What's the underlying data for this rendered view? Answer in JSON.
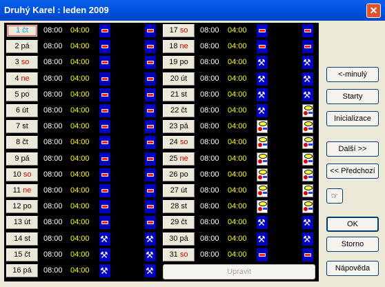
{
  "window": {
    "title": "Druhý Karel : leden 2009",
    "close_label": "✕"
  },
  "left_days": [
    {
      "num": "1",
      "wd": "čt",
      "t1": "08:00",
      "t2": "04:00",
      "i1": "bar",
      "i2": "bar",
      "selected": true
    },
    {
      "num": "2",
      "wd": "pá",
      "t1": "08:00",
      "t2": "04:00",
      "i1": "bar",
      "i2": "bar"
    },
    {
      "num": "3",
      "wd": "so",
      "t1": "08:00",
      "t2": "04:00",
      "i1": "bar",
      "i2": "bar",
      "weekend": true
    },
    {
      "num": "4",
      "wd": "ne",
      "t1": "08:00",
      "t2": "04:00",
      "i1": "bar",
      "i2": "bar",
      "weekend": true
    },
    {
      "num": "5",
      "wd": "po",
      "t1": "08:00",
      "t2": "04:00",
      "i1": "bar",
      "i2": "bar"
    },
    {
      "num": "6",
      "wd": "út",
      "t1": "08:00",
      "t2": "04:00",
      "i1": "bar",
      "i2": "bar"
    },
    {
      "num": "7",
      "wd": "st",
      "t1": "08:00",
      "t2": "04:00",
      "i1": "bar",
      "i2": "bar"
    },
    {
      "num": "8",
      "wd": "čt",
      "t1": "08:00",
      "t2": "04:00",
      "i1": "bar",
      "i2": "bar"
    },
    {
      "num": "9",
      "wd": "pá",
      "t1": "08:00",
      "t2": "04:00",
      "i1": "bar",
      "i2": "bar"
    },
    {
      "num": "10",
      "wd": "so",
      "t1": "08:00",
      "t2": "04:00",
      "i1": "bar",
      "i2": "bar",
      "weekend": true
    },
    {
      "num": "11",
      "wd": "ne",
      "t1": "08:00",
      "t2": "04:00",
      "i1": "bar",
      "i2": "bar",
      "weekend": true
    },
    {
      "num": "12",
      "wd": "po",
      "t1": "08:00",
      "t2": "04:00",
      "i1": "bar",
      "i2": "bar"
    },
    {
      "num": "13",
      "wd": "út",
      "t1": "08:00",
      "t2": "04:00",
      "i1": "bar",
      "i2": "bar"
    },
    {
      "num": "14",
      "wd": "st",
      "t1": "08:00",
      "t2": "04:00",
      "i1": "tools",
      "i2": "tools"
    },
    {
      "num": "15",
      "wd": "čt",
      "t1": "08:00",
      "t2": "04:00",
      "i1": "tools",
      "i2": "tools"
    },
    {
      "num": "16",
      "wd": "pá",
      "t1": "08:00",
      "t2": "04:00",
      "i1": "tools",
      "i2": "tools"
    }
  ],
  "right_days": [
    {
      "num": "17",
      "wd": "so",
      "t1": "08:00",
      "t2": "04:00",
      "i1": "bar",
      "i2": "bar",
      "weekend": true
    },
    {
      "num": "18",
      "wd": "ne",
      "t1": "08:00",
      "t2": "04:00",
      "i1": "bar",
      "i2": "bar",
      "weekend": true
    },
    {
      "num": "19",
      "wd": "po",
      "t1": "08:00",
      "t2": "04:00",
      "i1": "tools",
      "i2": "tools"
    },
    {
      "num": "20",
      "wd": "út",
      "t1": "08:00",
      "t2": "04:00",
      "i1": "tools",
      "i2": "tools"
    },
    {
      "num": "21",
      "wd": "st",
      "t1": "08:00",
      "t2": "04:00",
      "i1": "tools",
      "i2": "tools"
    },
    {
      "num": "22",
      "wd": "čt",
      "t1": "08:00",
      "t2": "04:00",
      "i1": "tools",
      "i2": "doc"
    },
    {
      "num": "23",
      "wd": "pá",
      "t1": "08:00",
      "t2": "04:00",
      "i1": "doc",
      "i2": "doc"
    },
    {
      "num": "24",
      "wd": "so",
      "t1": "08:00",
      "t2": "04:00",
      "i1": "doc",
      "i2": "doc",
      "weekend": true
    },
    {
      "num": "25",
      "wd": "ne",
      "t1": "08:00",
      "t2": "04:00",
      "i1": "doc",
      "i2": "doc",
      "weekend": true
    },
    {
      "num": "26",
      "wd": "po",
      "t1": "08:00",
      "t2": "04:00",
      "i1": "doc",
      "i2": "doc"
    },
    {
      "num": "27",
      "wd": "út",
      "t1": "08:00",
      "t2": "04:00",
      "i1": "doc",
      "i2": "doc"
    },
    {
      "num": "28",
      "wd": "st",
      "t1": "08:00",
      "t2": "04:00",
      "i1": "doc",
      "i2": "doc"
    },
    {
      "num": "29",
      "wd": "čt",
      "t1": "08:00",
      "t2": "04:00",
      "i1": "tools",
      "i2": "tools"
    },
    {
      "num": "30",
      "wd": "pá",
      "t1": "08:00",
      "t2": "04:00",
      "i1": "tools",
      "i2": "tools"
    },
    {
      "num": "31",
      "wd": "so",
      "t1": "08:00",
      "t2": "04:00",
      "i1": "bar",
      "i2": "bar",
      "weekend": true
    }
  ],
  "buttons": {
    "minuly": "<-minulý",
    "starty": "Starty",
    "inicializace": "Inicializace",
    "dalsi": "Další >>",
    "predchozi": "<< Předchozí",
    "ok": "OK",
    "storno": "Storno",
    "napoveda": "Nápověda",
    "upravit": "Upravit"
  },
  "colors": {
    "titlebar": "#0054e3",
    "grid_bg": "#000000",
    "time1": "#ffffff",
    "time2": "#ffff00",
    "weekend": "#d00000",
    "icon_bg": "#0000c0"
  }
}
